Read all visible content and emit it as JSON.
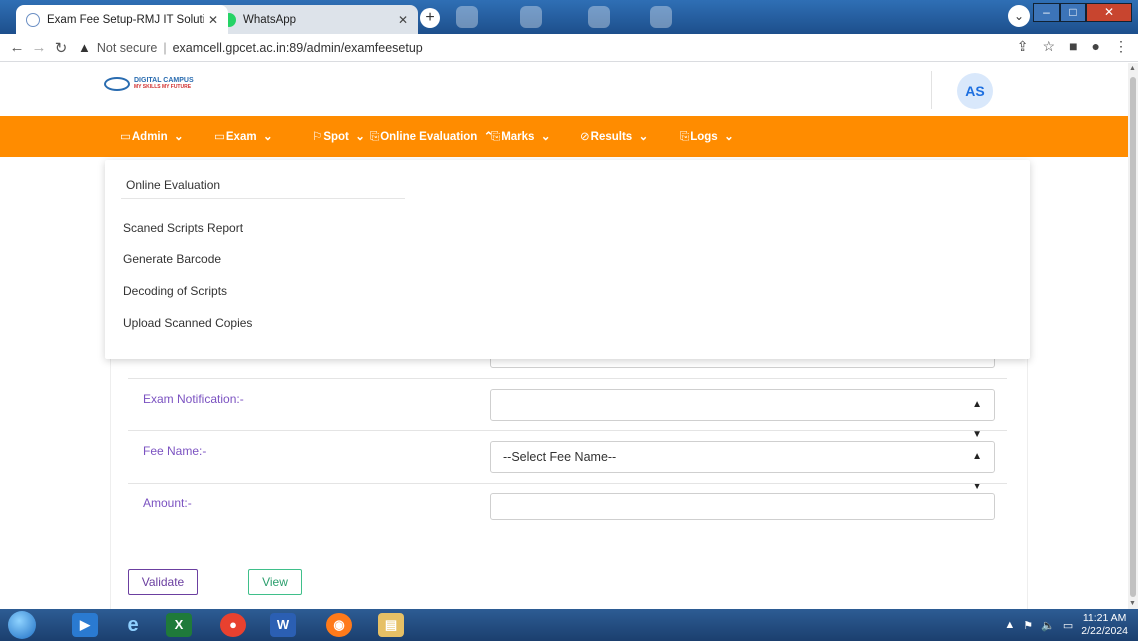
{
  "browser": {
    "tabs": [
      {
        "title": "Exam Fee Setup-RMJ IT Solution",
        "active": true
      },
      {
        "title": "WhatsApp",
        "active": false
      }
    ],
    "new_tab": "+",
    "url": {
      "security": "Not secure",
      "address": "examcell.gpcet.ac.in:89/admin/examfeesetup"
    }
  },
  "header": {
    "logo_text": "DIGITAL CAMPUS",
    "logo_tagline": "MY SKILLS MY FUTURE",
    "avatar_initials": "AS"
  },
  "nav": {
    "items": [
      {
        "label": "Admin"
      },
      {
        "label": "Exam"
      },
      {
        "label": "Spot"
      },
      {
        "label": "Online Evaluation"
      },
      {
        "label": "Marks"
      },
      {
        "label": "Results"
      },
      {
        "label": "Logs"
      }
    ]
  },
  "dropdown": {
    "title": "Online Evaluation",
    "items": [
      "Scaned Scripts Report",
      "Generate Barcode",
      "Decoding of Scripts",
      "Upload Scanned Copies"
    ]
  },
  "form": {
    "exam_notification_label": "Exam Notification:-",
    "exam_notification_value": "",
    "fee_name_label": "Fee Name:-",
    "fee_name_value": "--Select Fee Name--",
    "amount_label": "Amount:-",
    "amount_value": ""
  },
  "actions": {
    "validate_label": "Validate",
    "view_label": "View"
  },
  "taskbar": {
    "time": "11:21 AM",
    "date": "2/22/2024"
  },
  "colors": {
    "nav_bg": "#ff8c00",
    "label": "#7b52c1",
    "avatar_text": "#1d6fe0"
  }
}
